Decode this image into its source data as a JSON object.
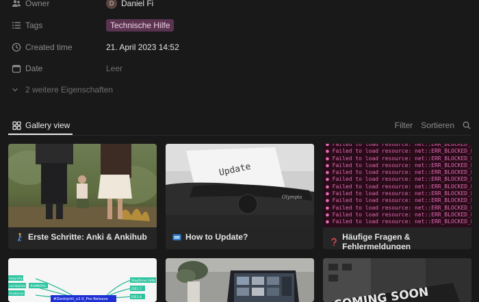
{
  "properties": {
    "owner": {
      "label": "Owner",
      "avatar_initial": "D",
      "value": "Daniel Fi"
    },
    "tags": {
      "label": "Tags",
      "value": "Technische Hilfe",
      "tag_color": "#5a3350"
    },
    "created": {
      "label": "Created time",
      "value": "21. April 2023 14:52"
    },
    "date": {
      "label": "Date",
      "value": "Leer"
    },
    "more_label": "2 weitere Eigenschaften"
  },
  "view": {
    "tab_label": "Gallery view",
    "filter_label": "Filter",
    "sort_label": "Sortieren"
  },
  "cards": [
    {
      "title": "Erste Schritte: Anki & Ankihub",
      "icon": "walking-person-icon"
    },
    {
      "title": "How to Update?",
      "icon": "new-badge-icon"
    },
    {
      "title": "Häufige Fragen & Fehlermeldungen",
      "icon": "question-mark-icon"
    }
  ],
  "thumb_text": {
    "update_paper": "Update",
    "typewriter_brand": "Olympia",
    "error_line": "Failed to load resource: net::ERR_BLOCKED_BY_AD",
    "mindmap_center": "#Zenkiphil_v2.0_Pre-Release",
    "mindmap_nodes_left": [
      "Vorprüfung",
      "Lernkarten",
      "#AMBOSS",
      "Anatomie"
    ],
    "mindmap_nodes_right": [
      "Stopfinner Hilfe",
      "IDE1.7",
      "IDE1.8"
    ],
    "coming_soon": "COMING SOON"
  },
  "colors": {
    "background": "#191919",
    "card": "#252525",
    "error_pink": "#e26bb5"
  }
}
